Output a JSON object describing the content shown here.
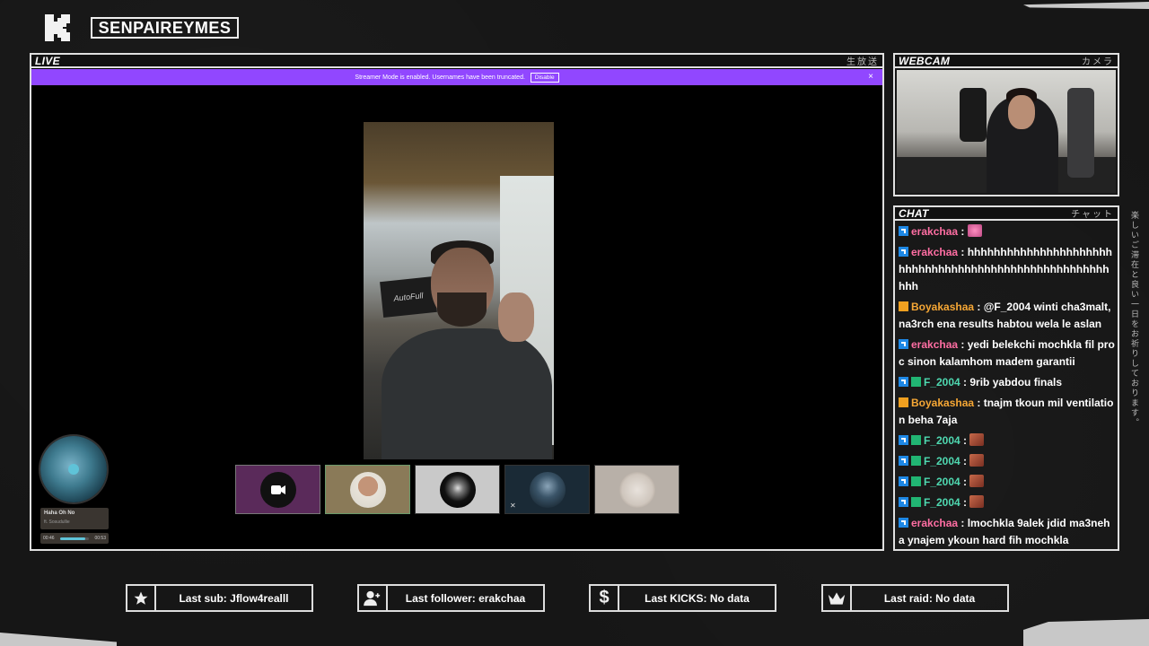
{
  "channel": {
    "name": "SENPAIREYMES"
  },
  "live_panel": {
    "label": "LIVE",
    "label_jp": "生放送",
    "banner_text": "Streamer Mode is enabled. Usernames have been truncated.",
    "banner_button": "Disable",
    "banner_close": "×",
    "main_video_chair_text": "AutoFull"
  },
  "music": {
    "song": "Haha Oh No",
    "artist": "ft. Sosudullie",
    "elapsed": "00:46",
    "duration": "00:53",
    "progress": 0.87
  },
  "webcam_panel": {
    "label": "WEBCAM",
    "label_jp": "カメラ"
  },
  "chat_panel": {
    "label": "CHAT",
    "label_jp": "チャット",
    "messages": [
      {
        "user": "erakchaa",
        "color": "#ff6ea3",
        "badges": [
          "kick"
        ],
        "text": "",
        "emotes": [
          "uni"
        ]
      },
      {
        "user": "erakchaa",
        "color": "#ff6ea3",
        "badges": [
          "kick"
        ],
        "text": "hhhhhhhhhhhhhhhhhhhhhhhhhhhhhhhhhhhhhhhhhhhhhhhhhhhhhhhhh"
      },
      {
        "user": "Boyakashaa",
        "color": "#f6a735",
        "badges": [
          "crown"
        ],
        "text": "@F_2004 winti cha3malt, na3rch ena results habtou wela le aslan"
      },
      {
        "user": "erakchaa",
        "color": "#ff6ea3",
        "badges": [
          "kick"
        ],
        "text": "yedi belekchi mochkla fil proc sinon kalamhom madem garantii"
      },
      {
        "user": "F_2004",
        "color": "#4fd8b0",
        "badges": [
          "kick",
          "grid"
        ],
        "text": "9rib yabdou finals"
      },
      {
        "user": "Boyakashaa",
        "color": "#f6a735",
        "badges": [
          "crown"
        ],
        "text": "tnajm tkoun mil ventilation beha 7aja"
      },
      {
        "user": "F_2004",
        "color": "#4fd8b0",
        "badges": [
          "kick",
          "grid"
        ],
        "text": "",
        "emotes": [
          "face"
        ]
      },
      {
        "user": "F_2004",
        "color": "#4fd8b0",
        "badges": [
          "kick",
          "grid"
        ],
        "text": "",
        "emotes": [
          "face"
        ]
      },
      {
        "user": "F_2004",
        "color": "#4fd8b0",
        "badges": [
          "kick",
          "grid"
        ],
        "text": "",
        "emotes": [
          "face"
        ]
      },
      {
        "user": "F_2004",
        "color": "#4fd8b0",
        "badges": [
          "kick",
          "grid"
        ],
        "text": "",
        "emotes": [
          "face"
        ]
      },
      {
        "user": "erakchaa",
        "color": "#ff6ea3",
        "badges": [
          "kick"
        ],
        "text": "lmochkla 9alek jdid ma3neha ynajem ykoun hard fih mochkla"
      }
    ]
  },
  "side_text_jp": "楽しいご滞在と良い一日をお祈りしております。",
  "stats": {
    "last_sub": "Last sub: Jflow4realll",
    "last_follower": "Last follower: erakchaa",
    "last_kicks": "Last KICKS: No data",
    "last_raid": "Last raid: No data"
  },
  "icons": {
    "logo": "kick-logo-icon",
    "sub": "star-icon",
    "follower": "add-user-icon",
    "kicks": "dollar-icon",
    "raid": "crown-icon"
  },
  "colors": {
    "banner": "#9147ff",
    "kick_badge": "#1e88e5",
    "music_accent": "#5fc3d8"
  }
}
